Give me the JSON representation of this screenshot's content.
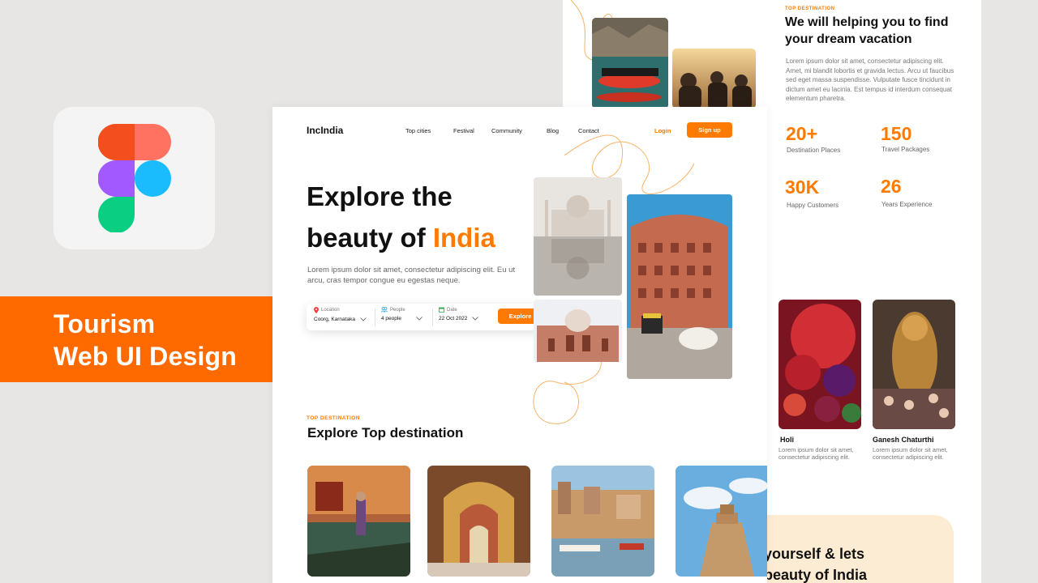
{
  "banner": {
    "line1": "Tourism",
    "line2": "Web UI Design"
  },
  "colors": {
    "accent": "#ff7a00",
    "banner": "#ff6a00",
    "cta_card": "#fdecd4"
  },
  "icons": [
    "figma-logo",
    "location-pin-icon",
    "people-icon",
    "calendar-icon",
    "chevron-down-icon"
  ],
  "front": {
    "logo": "IncIndia",
    "nav": [
      "Top cities",
      "Festival",
      "Community",
      "Blog",
      "Contact"
    ],
    "login": "Login",
    "signup": "Sign up",
    "hero": {
      "line1": "Explore the",
      "line2_prefix": "beauty of ",
      "line2_highlight": "India",
      "desc": "Lorem ipsum dolor sit amet, consectetur adipiscing elit. Eu ut arcu, cras tempor congue eu egestas neque."
    },
    "search": {
      "location_label": "Location",
      "location_value": "Coorg, Karnataka",
      "people_label": "People",
      "people_value": "4 people",
      "date_label": "Date",
      "date_value": "22 Oct 2022",
      "button": "Explore"
    },
    "section_kicker": "TOP DESTINATION",
    "section_title": "Explore Top destination"
  },
  "back": {
    "kicker": "TOP DESTINATION",
    "title": "We will helping you to find your dream vacation",
    "body": "Lorem ipsum dolor sit amet, consectetur adipiscing elit. Amet, mi blandit lobortis et gravida lectus. Arcu ut faucibus sed eget massa suspendisse. Vulputate fusce tincidunt in dictum amet eu lacinia. Est tempus id interdum consequat elementum pharetra.",
    "stats": [
      {
        "num": "20+",
        "label": "Destination Places"
      },
      {
        "num": "150",
        "label": "Travel Packages"
      },
      {
        "num": "30K",
        "label": "Happy Customers"
      },
      {
        "num": "26",
        "label": "Years Experience"
      }
    ],
    "festivals": [
      {
        "name": "Holi",
        "desc": "Lorem ipsum dolor sit amet, consectetur adipiscing elit."
      },
      {
        "name": "Ganesh Chaturthi",
        "desc": "Lorem ipsum dolor sit amet, consectetur adipiscing elit."
      }
    ],
    "cta_line1": "yourself & lets",
    "cta_line2": "beauty of India"
  }
}
